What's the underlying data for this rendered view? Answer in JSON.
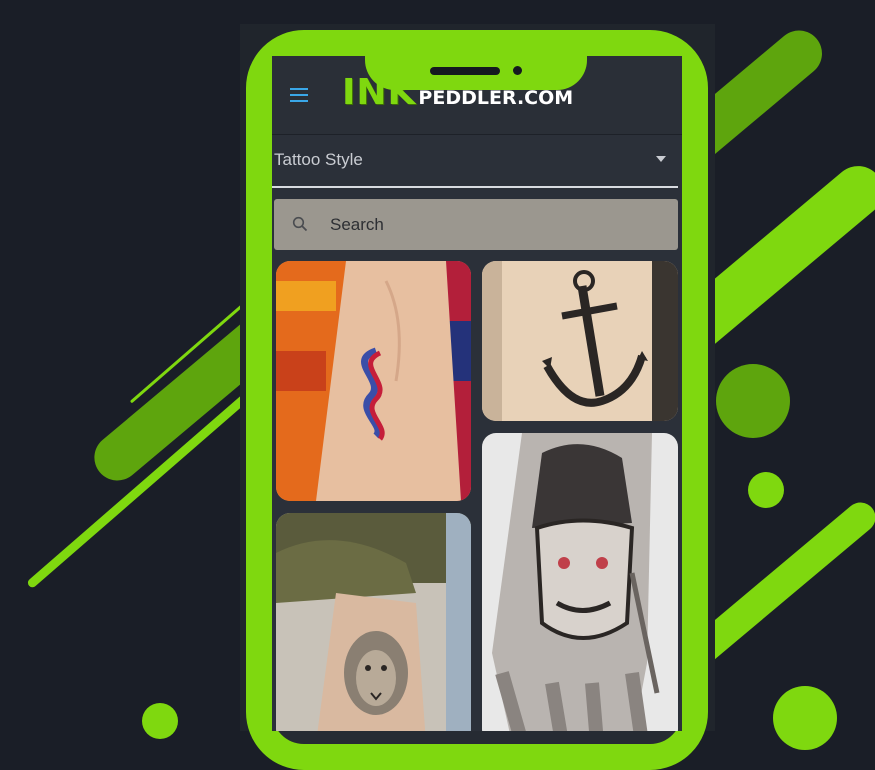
{
  "app": {
    "logo_ink": "INK",
    "logo_rest": "PEDDLER.COM"
  },
  "filter": {
    "label": "Tattoo Style"
  },
  "search": {
    "placeholder": "Search"
  },
  "gallery": {
    "items": [
      {
        "name": "red-blue-s-tattoo"
      },
      {
        "name": "anchor-tattoo"
      },
      {
        "name": "lion-tattoo"
      },
      {
        "name": "samurai-mask-hand-tattoo"
      }
    ]
  },
  "colors": {
    "background": "#1a1e27",
    "accent_green": "#7fd80f",
    "app_bar": "#2a2f37",
    "search_bg": "#9b978f",
    "menu_blue": "#3aa7e8"
  },
  "icons": {
    "menu": "hamburger-menu-icon",
    "search": "search-icon",
    "dropdown": "chevron-down-icon"
  }
}
